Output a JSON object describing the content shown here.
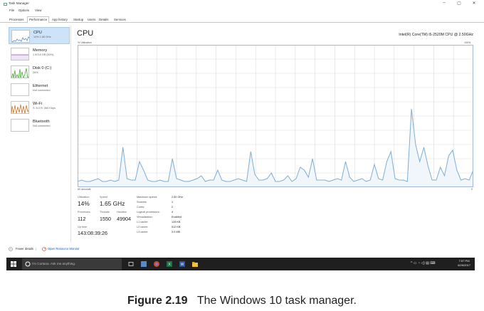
{
  "window": {
    "title": "Task Manager",
    "controls": [
      "–",
      "▢",
      "✕"
    ]
  },
  "menu": [
    "File",
    "Options",
    "View"
  ],
  "tabs": [
    "Processes",
    "Performance",
    "App history",
    "Startup",
    "Users",
    "Details",
    "Services"
  ],
  "active_tab": "Performance",
  "sidebar": {
    "items": [
      {
        "title": "CPU",
        "sub": "14% 1.65 GHz",
        "active": true
      },
      {
        "title": "Memory",
        "sub": "1.9/3.8 GB (50%)"
      },
      {
        "title": "Disk 0 (C:)",
        "sub": "26%"
      },
      {
        "title": "Ethernet",
        "sub": "Not connected"
      },
      {
        "title": "Wi-Fi",
        "sub": "S: 8.0  R: 360 Kbps"
      },
      {
        "title": "Bluetooth",
        "sub": "Not connected"
      }
    ]
  },
  "main": {
    "title": "CPU",
    "cpu_model": "Intel(R) Core(TM) i5-2520M CPU @ 2.50GHz",
    "y_label": "% Utilization",
    "y_max_label": "100%",
    "x_left_label": "60 seconds",
    "x_right_label": "0"
  },
  "stats": {
    "utilization_label": "Utilization",
    "utilization": "14%",
    "speed_label": "Speed",
    "speed": "1.65 GHz",
    "processes_label": "Processes",
    "processes": "112",
    "threads_label": "Threads",
    "threads": "1550",
    "handles_label": "Handles",
    "handles": "49904",
    "uptime_label": "Up time",
    "uptime": "143:08:39:26"
  },
  "details": [
    {
      "key": "Maximum speed:",
      "value": "2.50 GHz"
    },
    {
      "key": "Sockets:",
      "value": "1"
    },
    {
      "key": "Cores:",
      "value": "2"
    },
    {
      "key": "Logical processors:",
      "value": "4"
    },
    {
      "key": "Virtualization:",
      "value": "Enabled"
    },
    {
      "key": "L1 cache:",
      "value": "128 KB"
    },
    {
      "key": "L2 cache:",
      "value": "512 KB"
    },
    {
      "key": "L3 cache:",
      "value": "3.0 MB"
    }
  ],
  "footer": {
    "fewer_details": "Fewer details",
    "open_monitor": "Open Resource Monitor"
  },
  "taskbar": {
    "search_placeholder": "I'm Cortana. Ask me anything.",
    "time": "7:57 PM",
    "date": "6/26/2017"
  },
  "caption": {
    "label": "Figure 2.19",
    "text": "The Windows 10 task manager."
  },
  "colors": {
    "graph_line": "#7eaed6",
    "graph_fill": "#f1f6fb",
    "grid": "#dcdcdc",
    "selected_bg": "#cde3f7",
    "memory_line": "#8b4cb8",
    "disk_line": "#4ca83c",
    "wifi_line": "#c7782a"
  },
  "chart_data": {
    "type": "area",
    "x": [
      60,
      59,
      58,
      57,
      56,
      55,
      54,
      53,
      52,
      51,
      50,
      49,
      48,
      47,
      46,
      45,
      44,
      43,
      42,
      41,
      40,
      39,
      38,
      37,
      36,
      35,
      34,
      33,
      32,
      31,
      30,
      29,
      28,
      27,
      26,
      25,
      24,
      23,
      22,
      21,
      20,
      19,
      18,
      17,
      16,
      15,
      14,
      13,
      12,
      11,
      10,
      9,
      8,
      7,
      6,
      5,
      4,
      3,
      2,
      1,
      0
    ],
    "values": [
      4,
      5,
      4,
      4,
      5,
      6,
      4,
      4,
      5,
      4,
      5,
      28,
      6,
      5,
      5,
      18,
      12,
      5,
      4,
      4,
      5,
      4,
      4,
      20,
      6,
      5,
      4,
      4,
      5,
      6,
      8,
      4,
      5,
      5,
      12,
      5,
      4,
      4,
      5,
      6,
      5,
      4,
      25,
      9,
      5,
      5,
      6,
      10,
      4,
      4,
      5,
      8,
      4,
      6,
      14,
      12,
      7,
      20,
      5,
      5,
      5,
      4,
      5,
      6,
      5,
      18,
      7,
      4,
      5,
      6,
      4,
      5,
      16,
      6,
      5,
      18,
      25,
      6,
      5,
      5,
      4,
      55,
      30,
      18,
      28,
      15,
      5,
      5,
      14,
      8,
      22,
      26,
      12,
      5,
      6,
      5,
      12
    ],
    "ylim": [
      0,
      100
    ],
    "xlabel": "60 seconds",
    "ylabel": "% Utilization",
    "grid": true
  }
}
